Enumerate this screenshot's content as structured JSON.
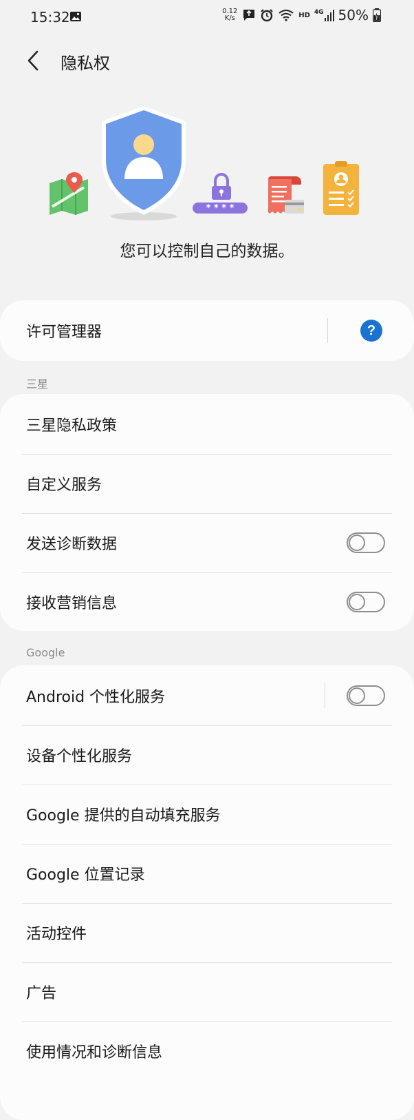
{
  "status_bar": {
    "time": "15:32",
    "net_speed_value": "0.12",
    "net_speed_unit": "K/s",
    "network_label": "HD",
    "signal_label": "4G",
    "battery": "50%"
  },
  "header": {
    "title": "隐私权"
  },
  "hero": {
    "caption": "您可以控制自己的数据。",
    "password_mask": "* * * *"
  },
  "permission_manager": {
    "label": "许可管理器"
  },
  "samsung_section": {
    "title": "三星",
    "items": [
      {
        "label": "三星隐私政策"
      },
      {
        "label": "自定义服务"
      },
      {
        "label": "发送诊断数据",
        "toggle": false
      },
      {
        "label": "接收营销信息",
        "toggle": false
      }
    ]
  },
  "google_section": {
    "title": "Google",
    "items": [
      {
        "label": "Android 个性化服务",
        "toggle": false
      },
      {
        "label": "设备个性化服务"
      },
      {
        "label": "Google 提供的自动填充服务"
      },
      {
        "label": "Google 位置记录"
      },
      {
        "label": "活动控件"
      },
      {
        "label": "广告"
      },
      {
        "label": "使用情况和诊断信息"
      }
    ]
  },
  "colors": {
    "shield": "#6b9ae8",
    "help_button": "#1a73d1",
    "lock": "#8b74dd",
    "receipt": "#ef6f61",
    "badge": "#f4b33d",
    "map": "#63c36a"
  }
}
